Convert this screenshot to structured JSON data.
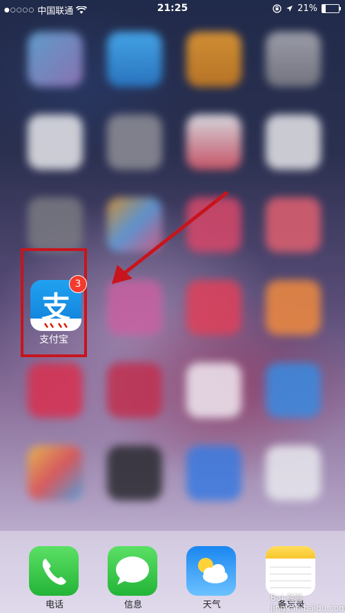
{
  "status_bar": {
    "signal_dots": "●○○○○",
    "carrier": "中国联通",
    "time": "21:25",
    "battery_percent": "21%",
    "battery_level": 0.21
  },
  "highlighted_app": {
    "name": "支付宝",
    "icon_glyph": "支",
    "badge_count": "3"
  },
  "dock": {
    "apps": [
      {
        "label": "电话"
      },
      {
        "label": "信息"
      },
      {
        "label": "天气"
      },
      {
        "label": "备忘录"
      }
    ]
  },
  "colors": {
    "highlight": "#c8141c",
    "alipay_blue": "#1a90e8",
    "badge_red": "#f43a2c"
  },
  "watermark": "Bai 经验 jingyan.baidu.com"
}
